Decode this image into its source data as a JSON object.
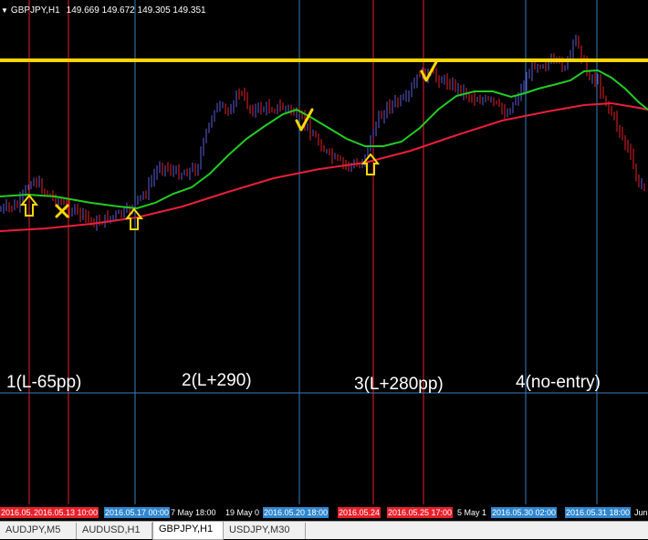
{
  "header": {
    "symbol_info": "GBPJPY,H1",
    "prices": "149.669 149.672 149.305 149.351"
  },
  "labels": {
    "trade1": "1(L-65pp)",
    "trade2": "2(L+290)",
    "trade3": "3(L+280pp)",
    "trade4": "4(no-entry)"
  },
  "time_axis": [
    {
      "text": "2016.05.1",
      "style": "red"
    },
    {
      "text": "2016.05.13 10:00",
      "style": "red"
    },
    {
      "text": "2016.05.17 00:00",
      "style": "blue"
    },
    {
      "text": "7 May 18:00",
      "style": "plain"
    },
    {
      "text": "19 May 0",
      "style": "plain"
    },
    {
      "text": "2016.05.20 18:00",
      "style": "blue"
    },
    {
      "text": "2016.05.24",
      "style": "red"
    },
    {
      "text": "2016.05.25 17:00",
      "style": "red"
    },
    {
      "text": "5 May 1",
      "style": "plain"
    },
    {
      "text": "2016.05.30 02:00",
      "style": "blue"
    },
    {
      "text": "2016.05.31 18:00",
      "style": "blue"
    },
    {
      "text": "Jun",
      "style": "plain"
    }
  ],
  "tabs": [
    {
      "label": "AUDJPY,M5",
      "active": false
    },
    {
      "label": "AUDUSD,H1",
      "active": false
    },
    {
      "label": "GBPJPY,H1",
      "active": true
    },
    {
      "label": "USDJPY,M30",
      "active": false
    }
  ],
  "colors": {
    "background": "#000000",
    "bull": "#5b5bd6",
    "bear": "#e8202a",
    "ma_fast": "#22cc22",
    "ma_slow": "#e8203a",
    "resistance": "#ffd700",
    "marker": "#ffd700",
    "vline_red": "#e8202a",
    "vline_blue": "#3a7bbf"
  },
  "markers": [
    {
      "type": "entry-arrow"
    },
    {
      "type": "exit-cross"
    },
    {
      "type": "entry-arrow"
    },
    {
      "type": "check"
    },
    {
      "type": "entry-arrow"
    },
    {
      "type": "check"
    }
  ]
}
